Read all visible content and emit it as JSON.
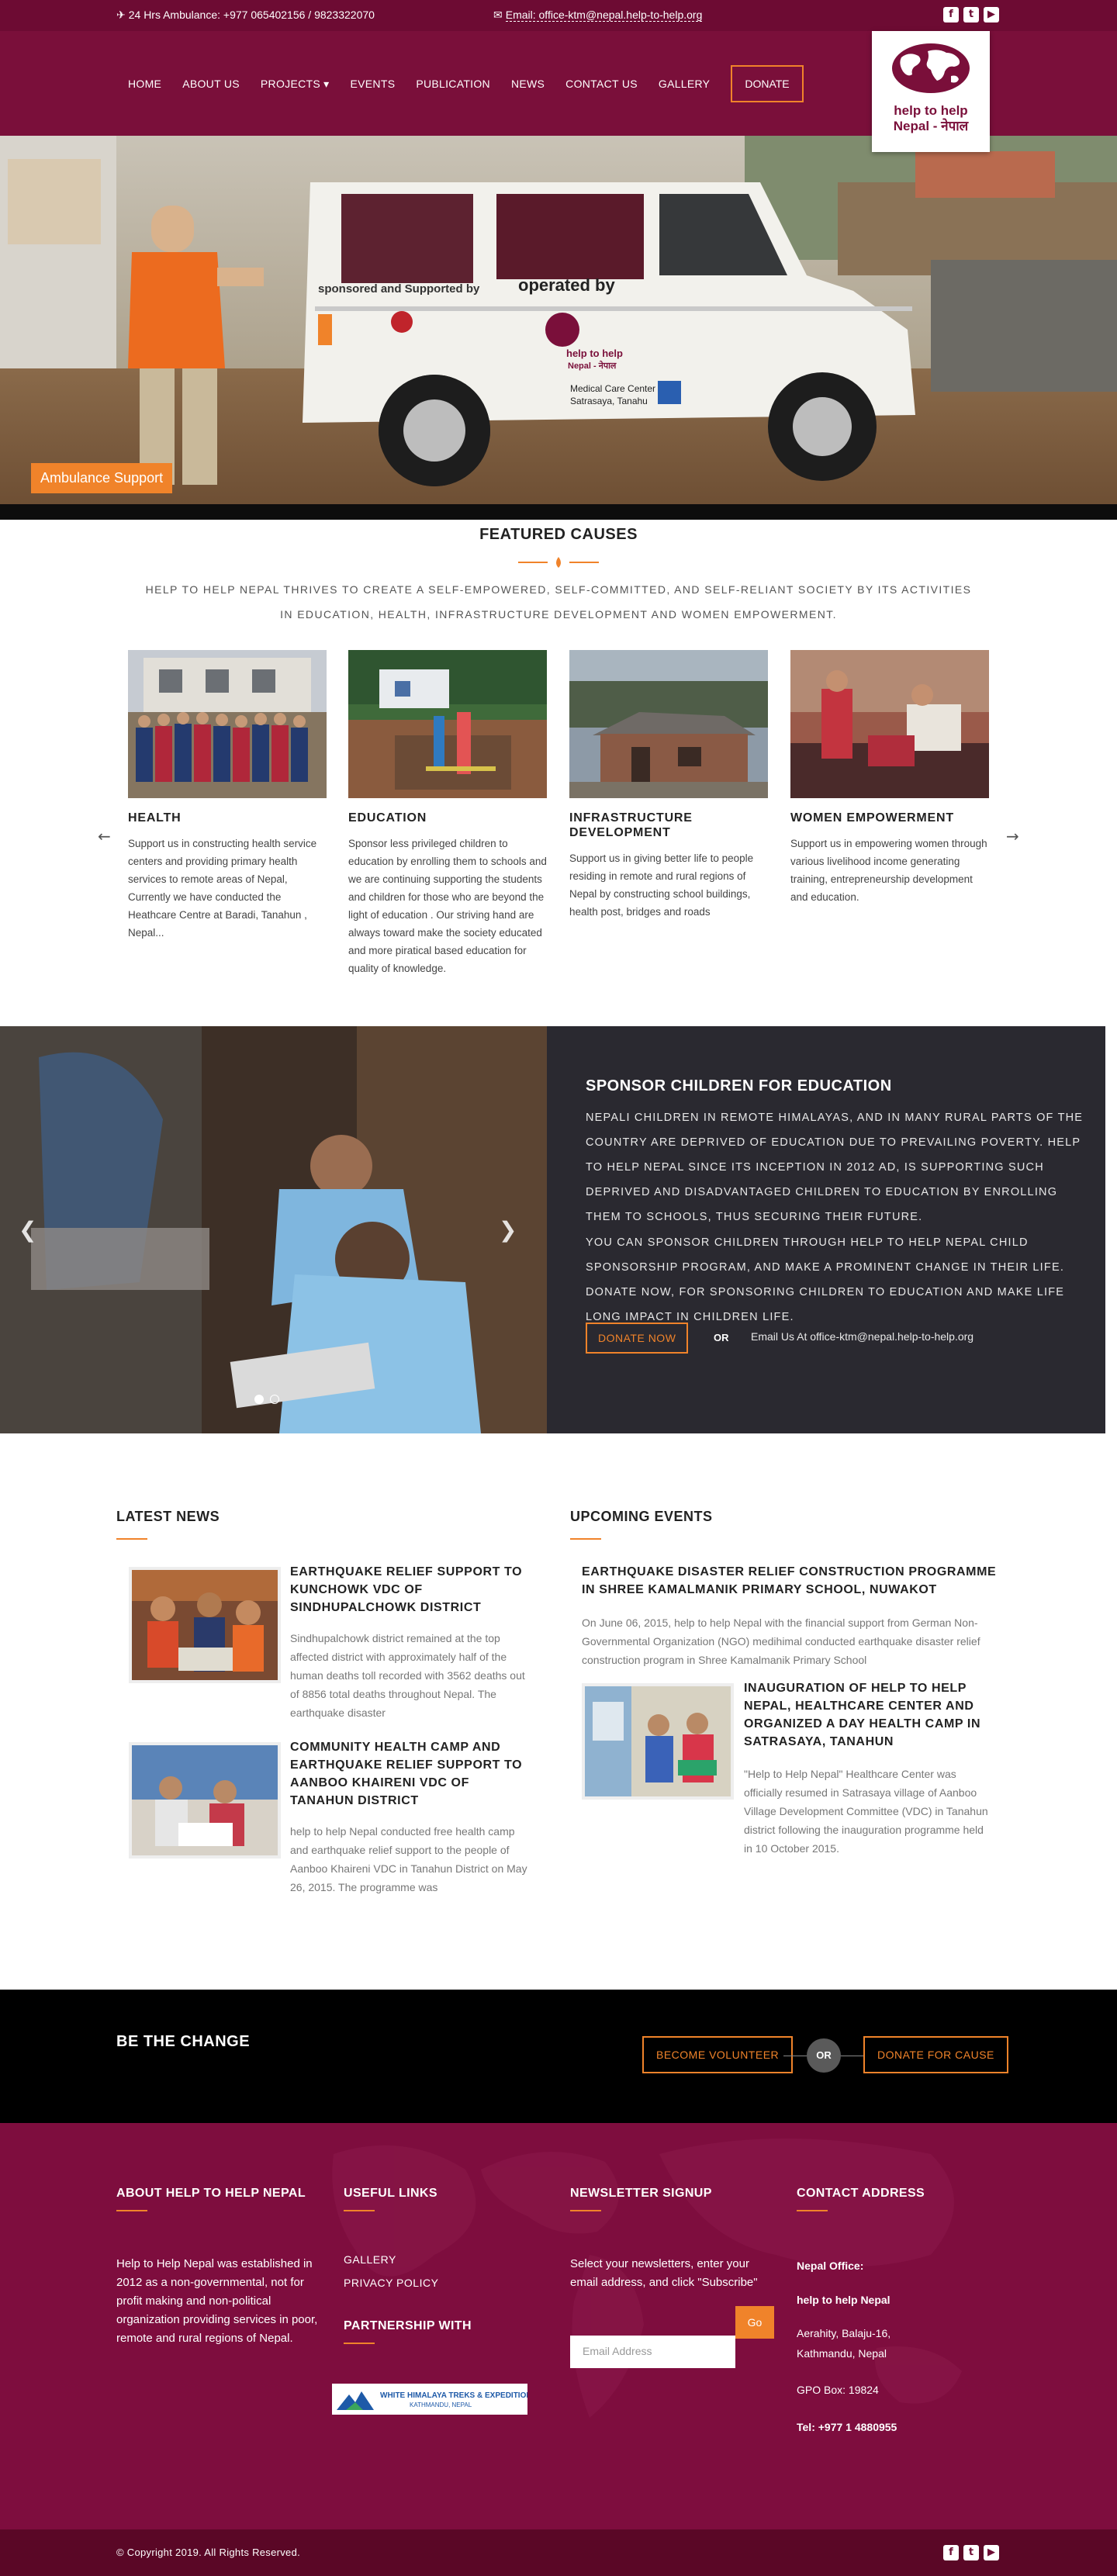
{
  "topbar": {
    "phone": "24 Hrs Ambulance: +977 065402156 / 9823322070",
    "email": "Email: office-ktm@nepal.help-to-help.org",
    "social": [
      "f",
      "t",
      "▶"
    ]
  },
  "nav": {
    "items": [
      "HOME",
      "ABOUT US",
      "PROJECTS ▾",
      "EVENTS",
      "PUBLICATION",
      "NEWS",
      "CONTACT US",
      "GALLERY"
    ],
    "donate": "DONATE"
  },
  "logo": {
    "line1": "help to help",
    "line2": "Nepal - नेपाल"
  },
  "hero": {
    "caption": "Ambulance Support",
    "vehicle_text": [
      "sponsored and Supported by",
      "operated by",
      "help to help",
      "Nepal - नेपाल",
      "Medical Care Center",
      "Satrasaya, Tanahu"
    ]
  },
  "featured": {
    "title": "FEATURED CAUSES",
    "intro": "HELP TO HELP NEPAL THRIVES TO CREATE A SELF-EMPOWERED, SELF-COMMITTED, AND SELF-RELIANT SOCIETY BY ITS ACTIVITIES IN EDUCATION, HEALTH, INFRASTRUCTURE DEVELOPMENT AND WOMEN EMPOWERMENT.",
    "prev": "←",
    "next": "→",
    "causes": [
      {
        "title": "HEALTH",
        "text": "Support us in constructing health service centers and providing primary health services to remote areas of Nepal, Currently we have conducted the Heathcare Centre at Baradi, Tanahun , Nepal..."
      },
      {
        "title": "EDUCATION",
        "text": "Sponsor less privileged children to education by enrolling them to schools and we are continuing supporting the students and children for those who are beyond the  light of education . Our striving hand are always toward make the society educated and more piratical based education  for quality of knowledge."
      },
      {
        "title": "INFRASTRUCTURE DEVELOPMENT",
        "text": "Support us in giving better life to people residing in remote and rural regions of Nepal by constructing school buildings, health post, bridges and roads"
      },
      {
        "title": "WOMEN EMPOWERMENT",
        "text": "Support us in empowering women through various livelihood income generating training, entrepreneurship development and education."
      }
    ]
  },
  "sponsor": {
    "title": "SPONSOR CHILDREN FOR EDUCATION",
    "p1": "NEPALI CHILDREN IN REMOTE HIMALAYAS, AND IN MANY RURAL PARTS OF THE COUNTRY ARE DEPRIVED OF EDUCATION DUE TO PREVAILING POVERTY. HELP TO HELP NEPAL SINCE ITS INCEPTION IN 2012 AD, IS SUPPORTING SUCH DEPRIVED AND DISADVANTAGED CHILDREN TO EDUCATION BY ENROLLING THEM TO SCHOOLS, THUS SECURING THEIR FUTURE.",
    "p2": "YOU CAN SPONSOR CHILDREN THROUGH HELP TO HELP NEPAL CHILD SPONSORSHIP PROGRAM, AND MAKE A PROMINENT CHANGE IN THEIR LIFE. DONATE NOW, FOR SPONSORING CHILDREN TO EDUCATION AND MAKE LIFE LONG IMPACT IN CHILDREN LIFE.",
    "donate": "DONATE NOW",
    "or": "OR",
    "mail": "Email Us At office-ktm@nepal.help-to-help.org",
    "prev": "❮",
    "next": "❯"
  },
  "news": {
    "heading": "LATEST NEWS",
    "items": [
      {
        "title": "EARTHQUAKE RELIEF SUPPORT TO KUNCHOWK VDC OF SINDHUPALCHOWK DISTRICT",
        "text": "Sindhupalchowk district remained at the top affected district with approximately half of the human deaths toll recorded with 3562 deaths out of 8856 total deaths throughout Nepal. The earthquake disaster"
      },
      {
        "title": "COMMUNITY HEALTH CAMP AND EARTHQUAKE RELIEF SUPPORT TO AANBOO KHAIRENI VDC OF TANAHUN DISTRICT",
        "text": "help to help Nepal conducted free health camp and earthquake relief support to the people of Aanboo Khaireni VDC in Tanahun District on May 26, 2015. The programme was"
      }
    ]
  },
  "events": {
    "heading": "UPCOMING EVENTS",
    "items": [
      {
        "title": "EARTHQUAKE DISASTER RELIEF CONSTRUCTION PROGRAMME IN SHREE KAMALMANIK PRIMARY SCHOOL, NUWAKOT",
        "text": "On June 06, 2015, help to help Nepal with the financial support from German Non- Governmental Organization (NGO) medihimal conducted earthquake disaster relief construction program in Shree Kamalmanik Primary School"
      },
      {
        "title": "INAUGURATION OF HELP TO HELP NEPAL, HEALTHCARE CENTER AND ORGANIZED A DAY HEALTH CAMP IN SATRASAYA, TANAHUN",
        "text": "\"Help to Help Nepal\" Healthcare Center was officially resumed in Satrasaya village of Aanboo Village Development Committee (VDC) in Tanahun district following the inauguration programme held in 10 October 2015."
      }
    ]
  },
  "change": {
    "title": "BE THE CHANGE",
    "volunteer": "BECOME VOLUNTEER",
    "or": "OR",
    "donate": "DONATE FOR CAUSE"
  },
  "footer": {
    "about_h": "ABOUT HELP TO HELP NEPAL",
    "about": "Help to Help Nepal was established in 2012 as a non-governmental, not for profit making and non-political organization providing services in poor, remote and rural regions of Nepal.",
    "links_h": "USEFUL LINKS",
    "links": [
      "GALLERY",
      "PRIVACY POLICY"
    ],
    "partner_h": "PARTNERSHIP WITH",
    "partner_name": "WHITE HIMALAYA TREKS & EXPEDITION",
    "partner_city": "KATHMANDU, NEPAL",
    "news_h": "NEWSLETTER SIGNUP",
    "news_text": "Select your newsletters, enter your email address, and click \"Subscribe\"",
    "go": "Go",
    "email_placeholder": "Email Address",
    "contact_h": "CONTACT ADDRESS",
    "office": "Nepal Office:",
    "org": "help to help Nepal",
    "addr": "Aerahity, Balaju-16,  Kathmandu, Nepal",
    "box": "GPO Box: 19824",
    "tel": "Tel: +977 1 4880955"
  },
  "bottom": {
    "copy": "© Copyright 2019. All Rights Reserved."
  },
  "colors": {
    "brand": "#7a0f3a",
    "accent": "#f0832a",
    "dark": "#2a2930"
  }
}
